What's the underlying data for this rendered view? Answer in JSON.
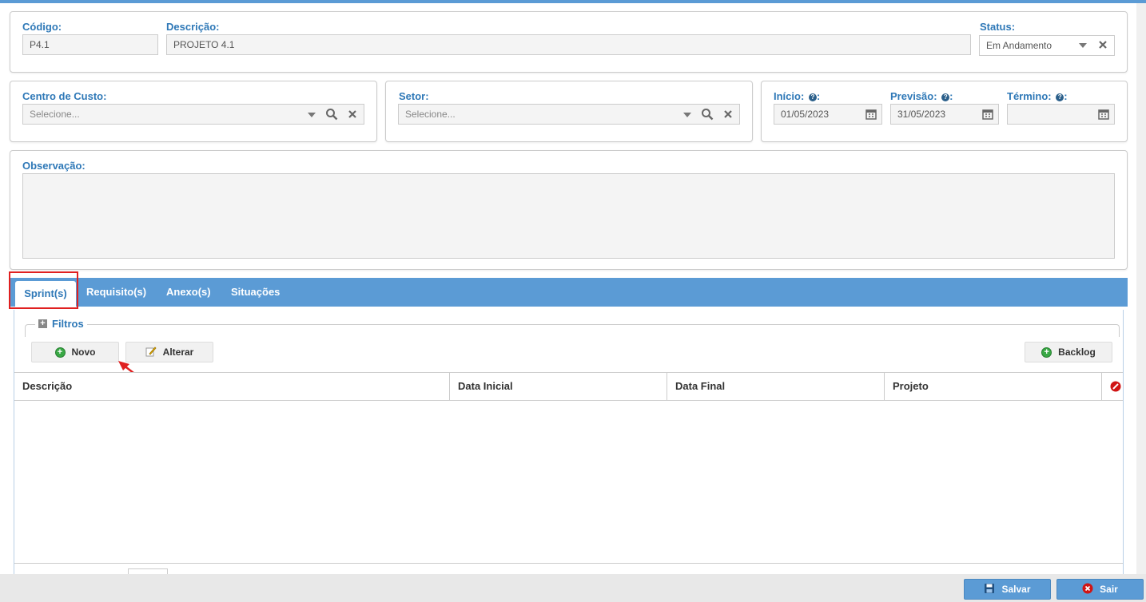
{
  "header": {
    "codigo_label": "Código:",
    "codigo_value": "P4.1",
    "descricao_label": "Descrição:",
    "descricao_value": "PROJETO 4.1",
    "status_label": "Status:",
    "status_value": "Em Andamento"
  },
  "centro_custo": {
    "label": "Centro de Custo:",
    "placeholder": "Selecione..."
  },
  "setor": {
    "label": "Setor:",
    "placeholder": "Selecione..."
  },
  "dates": {
    "inicio_label": "Início:",
    "inicio_value": "01/05/2023",
    "previsao_label": "Previsão:",
    "previsao_value": "31/05/2023",
    "termino_label": "Término:",
    "termino_value": "",
    "help_glyph": "?"
  },
  "observacao": {
    "label": "Observação:",
    "value": ""
  },
  "tabs": [
    {
      "label": "Sprint(s)"
    },
    {
      "label": "Requisito(s)"
    },
    {
      "label": "Anexo(s)"
    },
    {
      "label": "Situações"
    }
  ],
  "filters": {
    "label": "Filtros"
  },
  "toolbar": {
    "novo": "Novo",
    "alterar": "Alterar",
    "backlog": "Backlog"
  },
  "table": {
    "columns": [
      "Descrição",
      "Data Inicial",
      "Data Final",
      "Projeto"
    ],
    "rows": []
  },
  "footer": {
    "salvar": "Salvar",
    "sair": "Sair"
  },
  "colors": {
    "accent": "#5b9bd5",
    "label": "#2e78b7",
    "highlight": "#e02020"
  }
}
